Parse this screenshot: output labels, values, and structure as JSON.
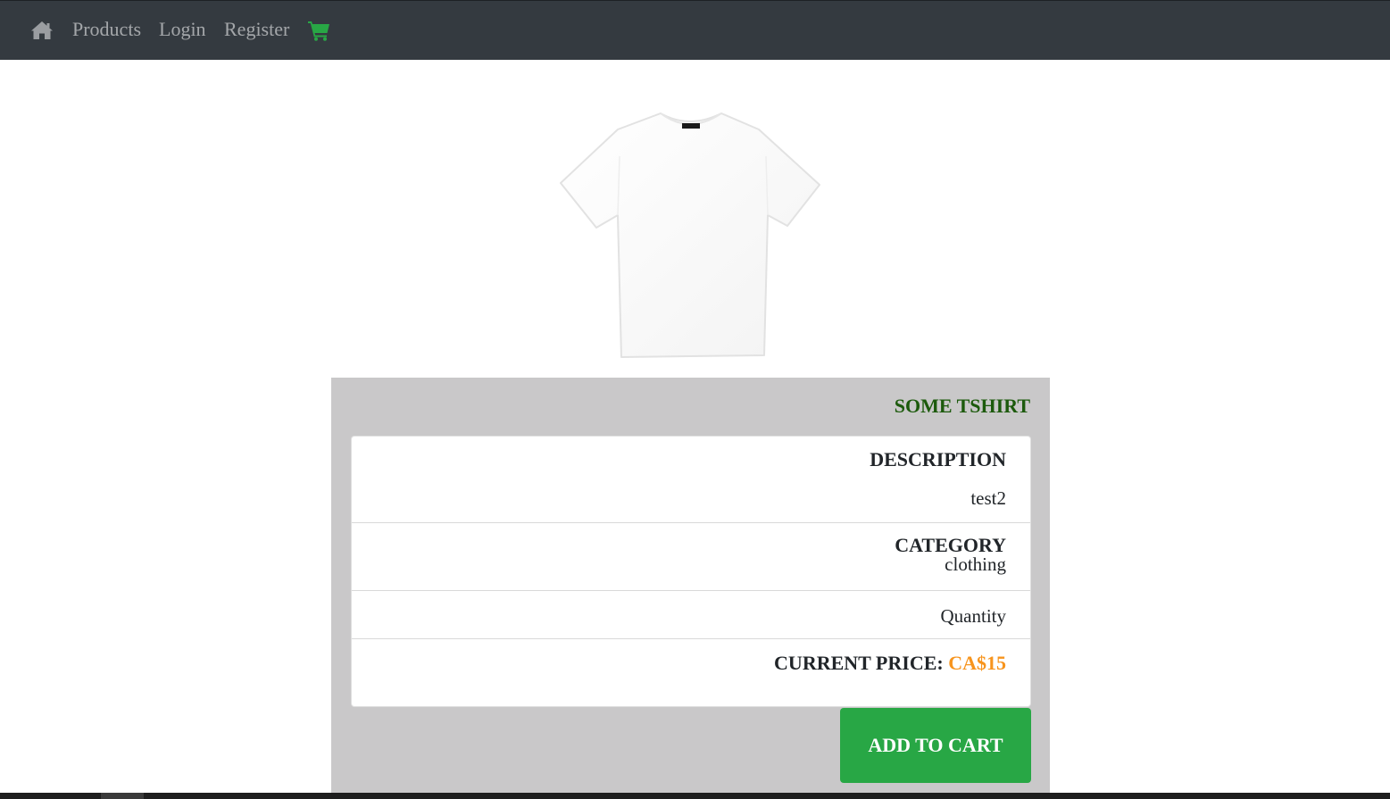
{
  "navbar": {
    "home_icon": "home-icon",
    "links": [
      {
        "label": "Products"
      },
      {
        "label": "Login"
      },
      {
        "label": "Register"
      }
    ],
    "cart_icon": "shopping-cart-icon",
    "cart_icon_color": "#28a745"
  },
  "product": {
    "image": "white-tshirt-image",
    "title": "SOME TSHIRT",
    "description_heading": "DESCRIPTION",
    "description": "test2",
    "category_heading": "CATEGORY",
    "category": "clothing",
    "quantity_label": "Quantity",
    "price_heading": "CURRENT PRICE:",
    "price": "CA$15",
    "add_to_cart_label": "ADD TO CART"
  },
  "colors": {
    "navbar_bg": "#343a40",
    "title": "#1c5a0c",
    "price": "#f7941d",
    "button": "#28a745",
    "panel_bg": "#c9c8c9"
  }
}
